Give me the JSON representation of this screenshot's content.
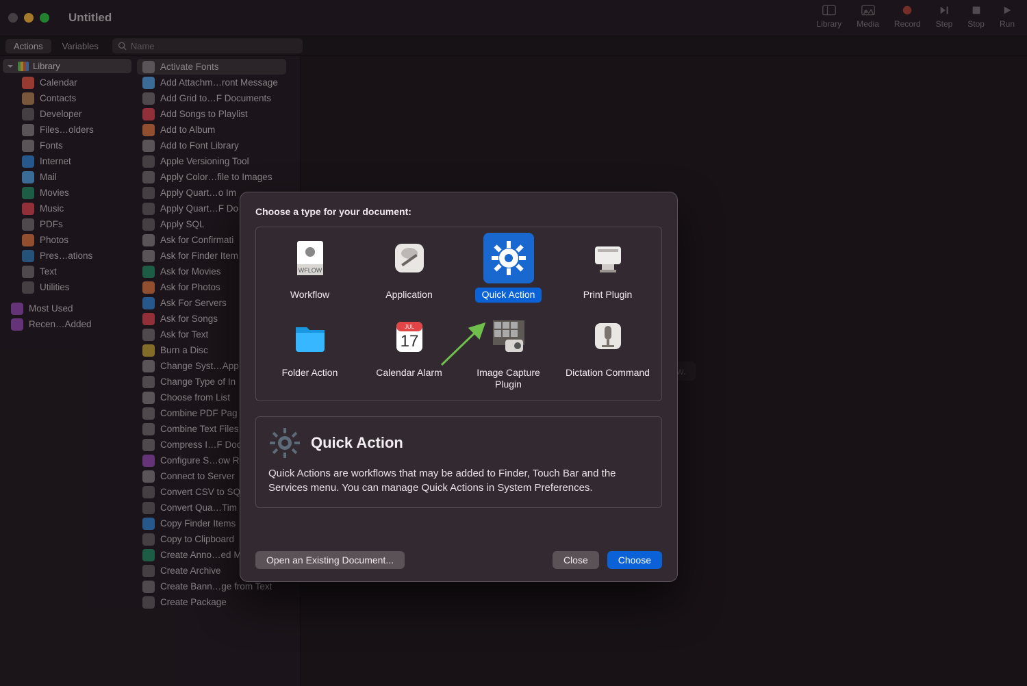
{
  "window": {
    "title": "Untitled"
  },
  "toolbar": {
    "library": "Library",
    "media": "Media",
    "record": "Record",
    "step": "Step",
    "stop": "Stop",
    "run": "Run"
  },
  "filter": {
    "actions": "Actions",
    "variables": "Variables",
    "search_placeholder": "Name"
  },
  "library": {
    "header": "Library",
    "items": [
      {
        "label": "Calendar",
        "color": "#e85b4d"
      },
      {
        "label": "Contacts",
        "color": "#b9865c"
      },
      {
        "label": "Developer",
        "color": "#6a6268"
      },
      {
        "label": "Files…olders",
        "color": "#8a8088"
      },
      {
        "label": "Fonts",
        "color": "#8a8088"
      },
      {
        "label": "Internet",
        "color": "#3d88d6"
      },
      {
        "label": "Mail",
        "color": "#59a7e8"
      },
      {
        "label": "Movies",
        "color": "#2f8f6a"
      },
      {
        "label": "Music",
        "color": "#e04a5a"
      },
      {
        "label": "PDFs",
        "color": "#7a7178"
      },
      {
        "label": "Photos",
        "color": "#e07a4a"
      },
      {
        "label": "Pres…ations",
        "color": "#3a7fb8"
      },
      {
        "label": "Text",
        "color": "#7a7178"
      },
      {
        "label": "Utilities",
        "color": "#6a6268"
      }
    ],
    "extra": [
      {
        "label": "Most Used",
        "color": "#9a4fb8"
      },
      {
        "label": "Recen…Added",
        "color": "#9a4fb8"
      }
    ]
  },
  "actions_list": [
    {
      "label": "Activate Fonts",
      "color": "#8a8088",
      "selected": true
    },
    {
      "label": "Add Attachm…ront Message",
      "color": "#59a7e8"
    },
    {
      "label": "Add Grid to…F Documents",
      "color": "#7a7178"
    },
    {
      "label": "Add Songs to Playlist",
      "color": "#e04a5a"
    },
    {
      "label": "Add to Album",
      "color": "#e07a4a"
    },
    {
      "label": "Add to Font Library",
      "color": "#8a8088"
    },
    {
      "label": "Apple Versioning Tool",
      "color": "#6a6268"
    },
    {
      "label": "Apply Color…file to Images",
      "color": "#7a7178"
    },
    {
      "label": "Apply Quart…o Im",
      "color": "#6a6268"
    },
    {
      "label": "Apply Quart…F Do",
      "color": "#6a6268"
    },
    {
      "label": "Apply SQL",
      "color": "#6a6268"
    },
    {
      "label": "Ask for Confirmati",
      "color": "#8a8088"
    },
    {
      "label": "Ask for Finder Item",
      "color": "#8a8088"
    },
    {
      "label": "Ask for Movies",
      "color": "#2f8f6a"
    },
    {
      "label": "Ask for Photos",
      "color": "#e07a4a"
    },
    {
      "label": "Ask For Servers",
      "color": "#3d88d6"
    },
    {
      "label": "Ask for Songs",
      "color": "#e04a5a"
    },
    {
      "label": "Ask for Text",
      "color": "#7a7178"
    },
    {
      "label": "Burn a Disc",
      "color": "#c9a63d"
    },
    {
      "label": "Change Syst…App",
      "color": "#8a8088"
    },
    {
      "label": "Change Type of In",
      "color": "#7a7178"
    },
    {
      "label": "Choose from List",
      "color": "#8a8088"
    },
    {
      "label": "Combine PDF Pag",
      "color": "#7a7178"
    },
    {
      "label": "Combine Text Files",
      "color": "#7a7178"
    },
    {
      "label": "Compress I…F Doc",
      "color": "#7a7178"
    },
    {
      "label": "Configure S…ow R",
      "color": "#9a4fb8"
    },
    {
      "label": "Connect to Server",
      "color": "#8a8088"
    },
    {
      "label": "Convert CSV to SQ",
      "color": "#6a6268"
    },
    {
      "label": "Convert Qua…Tim",
      "color": "#6a6268"
    },
    {
      "label": "Copy Finder Items",
      "color": "#3d88d6"
    },
    {
      "label": "Copy to Clipboard",
      "color": "#6a6268"
    },
    {
      "label": "Create Anno…ed M",
      "color": "#2f8f6a"
    },
    {
      "label": "Create Archive",
      "color": "#6a6268"
    },
    {
      "label": "Create Bann…ge from Text",
      "color": "#7a7178"
    },
    {
      "label": "Create Package",
      "color": "#6a6268"
    }
  ],
  "main": {
    "placeholder": "workflow."
  },
  "sheet": {
    "prompt": "Choose a type for your document:",
    "types": [
      {
        "label": "Workflow"
      },
      {
        "label": "Application"
      },
      {
        "label": "Quick Action",
        "selected": true
      },
      {
        "label": "Print Plugin"
      },
      {
        "label": "Folder Action"
      },
      {
        "label": "Calendar Alarm"
      },
      {
        "label": "Image Capture Plugin"
      },
      {
        "label": "Dictation Command"
      }
    ],
    "desc_title": "Quick Action",
    "desc_body": "Quick Actions are workflows that may be added to Finder, Touch Bar and the Services menu. You can manage Quick Actions in System Preferences.",
    "open_existing": "Open an Existing Document...",
    "close": "Close",
    "choose": "Choose"
  }
}
